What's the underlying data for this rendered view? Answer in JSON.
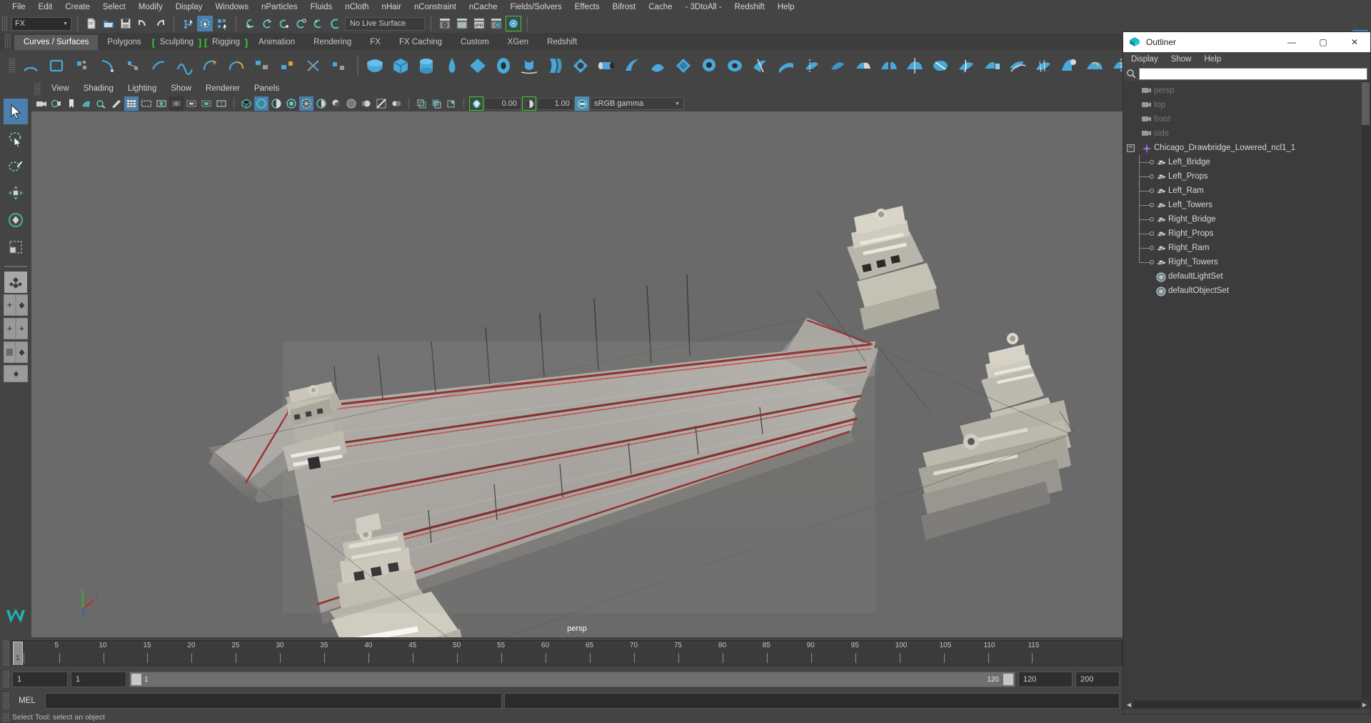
{
  "app": {
    "menubar": [
      "File",
      "Edit",
      "Create",
      "Select",
      "Modify",
      "Display",
      "Windows",
      "nParticles",
      "Fluids",
      "nCloth",
      "nHair",
      "nConstraint",
      "nCache",
      "Fields/Solvers",
      "Effects",
      "Bifrost",
      "Cache",
      "- 3DtoAll -",
      "Redshift",
      "Help"
    ]
  },
  "statusline": {
    "menuset": "FX",
    "menuset_arrow": "▼",
    "live_surface": "No Live Surface",
    "icons": [
      "new-scene-icon",
      "open-scene-icon",
      "save-scene-icon",
      "undo-icon",
      "redo-icon",
      "select-by-hierarchy-icon",
      "select-by-object-icon",
      "select-by-component-icon",
      "snap-to-grid-icon",
      "snap-to-curve-icon",
      "snap-to-point-icon",
      "snap-to-projected-center-icon",
      "snap-to-view-plane-icon",
      "make-live-icon",
      "render-view-icon",
      "render-current-frame-icon",
      "ipr-render-icon",
      "render-settings-icon",
      "hypershade-icon"
    ],
    "right_icons": [
      "sidebar-attribute-editor-icon",
      "sidebar-tool-settings-icon",
      "sidebar-channel-box-icon",
      "sidebar-layer-editor-icon"
    ]
  },
  "shelf": {
    "tabs": [
      {
        "label": "Curves / Surfaces",
        "active": true,
        "bracket": false
      },
      {
        "label": "Polygons",
        "active": false,
        "bracket": false
      },
      {
        "label": "Sculpting",
        "active": false,
        "bracket": true
      },
      {
        "label": "Rigging",
        "active": false,
        "bracket": true
      },
      {
        "label": "Animation",
        "active": false,
        "bracket": false
      },
      {
        "label": "Rendering",
        "active": false,
        "bracket": false
      },
      {
        "label": "FX",
        "active": false,
        "bracket": false
      },
      {
        "label": "FX Caching",
        "active": false,
        "bracket": false
      },
      {
        "label": "Custom",
        "active": false,
        "bracket": false
      },
      {
        "label": "XGen",
        "active": false,
        "bracket": false
      },
      {
        "label": "Redshift",
        "active": false,
        "bracket": false
      }
    ],
    "icons": [
      "nurbs-arc-icon",
      "nurbs-square-icon",
      "nurbs-text-icon",
      "nurbs-curve-ep-icon",
      "nurbs-curve-cv-icon",
      "nurbs-pencil-curve-icon",
      "nurbs-bezier-icon",
      "nurbs-three-point-arc-icon",
      "nurbs-attach-curve-icon",
      "nurbs-detach-curve-icon",
      "nurbs-open-close-curve-icon",
      "nurbs-cut-curve-icon",
      "nurbs-fillet-curve-icon",
      "nurbs-insert-knot-icon",
      "nurbs-offset-curve-icon",
      "nurbs-rebuild-curve-icon",
      "nurbs-reverse-curve-icon",
      "nurbs-sphere-icon",
      "nurbs-cube-icon",
      "nurbs-cylinder-icon",
      "nurbs-cone-icon",
      "nurbs-plane-icon",
      "nurbs-torus-icon",
      "nurbs-revolve-icon",
      "nurbs-loft-icon",
      "nurbs-planar-icon",
      "nurbs-extrude-icon",
      "nurbs-birail-icon",
      "nurbs-boundary-icon",
      "nurbs-square-surface-icon",
      "nurbs-bevel-icon",
      "nurbs-bevel-plus-icon",
      "nurbs-intersect-surfaces-icon",
      "nurbs-project-curve-icon",
      "nurbs-trim-tool-icon",
      "nurbs-untrim-icon",
      "nurbs-attach-surfaces-icon",
      "nurbs-detach-surfaces-icon",
      "nurbs-align-surfaces-icon",
      "nurbs-open-close-surfaces-icon",
      "nurbs-insert-isoparm-icon",
      "nurbs-extend-surface-icon",
      "nurbs-offset-surface-icon",
      "nurbs-rebuild-surface-icon",
      "nurbs-round-tool-icon",
      "nurbs-surface-fillet-icon",
      "nurbs-stitch-icon",
      "nurbs-sculpt-geometry-icon",
      "nurbs-surface-editing-icon"
    ]
  },
  "toolbox": {
    "tools": [
      {
        "name": "select-tool",
        "active": true
      },
      {
        "name": "lasso-select-tool",
        "active": false
      },
      {
        "name": "paint-select-tool",
        "active": false
      },
      {
        "name": "move-tool",
        "active": false
      },
      {
        "name": "rotate-tool",
        "active": false
      },
      {
        "name": "scale-tool",
        "active": false
      }
    ],
    "layout_buttons": [
      "single-perspective-layout",
      "four-view-layout",
      "persp-outliner-layout",
      "persp-graph-layout",
      "outliner-persp-layout",
      "hypershade-persp-layout",
      "persp-only-layout"
    ]
  },
  "viewport": {
    "menus": [
      "View",
      "Shading",
      "Lighting",
      "Show",
      "Renderer",
      "Panels"
    ],
    "camera_label": "persp",
    "exposure_value": "0.00",
    "gamma_value": "1.00",
    "color_management": "sRGB gamma",
    "dropdown_arrow": "▼",
    "toolbar_icons": [
      "select-camera-icon",
      "camera-attributes-icon",
      "bookmark-icon",
      "image-plane-icon",
      "two-d-pan-zoom-icon",
      "grease-pencil-icon",
      "grid-toggle-icon",
      "film-gate-icon",
      "resolution-gate-icon",
      "gate-mask-icon",
      "film-origin-icon",
      "safe-action-icon",
      "safe-title-icon",
      "wireframe-shading-icon",
      "smooth-shade-all-icon",
      "smooth-shade-selected-icon",
      "flat-shade-icon",
      "shaded-wireframe-icon",
      "textured-icon",
      "lighting-icon",
      "shadows-icon",
      "screen-space-ao-icon",
      "motion-blur-icon",
      "multisample-aa-icon",
      "depth-of-field-icon",
      "isolate-select-icon",
      "xray-icon",
      "xray-joints-icon",
      "xray-active-components-icon",
      "exposure-icon",
      "gamma-icon",
      "color-management-icon"
    ],
    "axis_labels": [
      "x",
      "y",
      "z"
    ],
    "axis_colors": {
      "x": "#d02020",
      "y": "#2fbf2f",
      "z": "#2e5fd0"
    }
  },
  "timeline": {
    "ticks": [
      1,
      5,
      10,
      15,
      20,
      25,
      30,
      35,
      40,
      45,
      50,
      55,
      60,
      65,
      70,
      75,
      80,
      85,
      90,
      95,
      100,
      105,
      110,
      115
    ],
    "current_frame": "1",
    "range_start": "1",
    "range_end": "120",
    "anim_start": "1",
    "anim_end": "120",
    "playback_end": "200",
    "slider_start_value": "1",
    "slider_end_value": "120"
  },
  "command_line": {
    "language": "MEL",
    "input_value": "",
    "output_value": ""
  },
  "help_line": {
    "text": "Select Tool: select an object"
  },
  "outliner": {
    "title": "Outliner",
    "window_icon": "maya-outliner-icon",
    "minimize": "—",
    "maximize": "▢",
    "close": "✕",
    "menus": [
      "Display",
      "Show",
      "Help"
    ],
    "search_value": "",
    "items": [
      {
        "label": "persp",
        "icon": "camera-icon",
        "depth": 0,
        "dim": true,
        "expand": false,
        "tree": "none"
      },
      {
        "label": "top",
        "icon": "camera-icon",
        "depth": 0,
        "dim": true,
        "expand": false,
        "tree": "none"
      },
      {
        "label": "front",
        "icon": "camera-icon",
        "depth": 0,
        "dim": true,
        "expand": false,
        "tree": "none"
      },
      {
        "label": "side",
        "icon": "camera-icon",
        "depth": 0,
        "dim": true,
        "expand": false,
        "tree": "none"
      },
      {
        "label": "Chicago_Drawbridge_Lowered_ncl1_1",
        "icon": "group-icon",
        "depth": 0,
        "dim": false,
        "expand": true,
        "tree": "none"
      },
      {
        "label": "Left_Bridge",
        "icon": "mesh-icon",
        "depth": 1,
        "dim": false,
        "expand": false,
        "tree": "mid"
      },
      {
        "label": "Left_Props",
        "icon": "mesh-icon",
        "depth": 1,
        "dim": false,
        "expand": false,
        "tree": "mid"
      },
      {
        "label": "Left_Ram",
        "icon": "mesh-icon",
        "depth": 1,
        "dim": false,
        "expand": false,
        "tree": "mid"
      },
      {
        "label": "Left_Towers",
        "icon": "mesh-icon",
        "depth": 1,
        "dim": false,
        "expand": false,
        "tree": "mid"
      },
      {
        "label": "Right_Bridge",
        "icon": "mesh-icon",
        "depth": 1,
        "dim": false,
        "expand": false,
        "tree": "mid"
      },
      {
        "label": "Right_Props",
        "icon": "mesh-icon",
        "depth": 1,
        "dim": false,
        "expand": false,
        "tree": "mid"
      },
      {
        "label": "Right_Ram",
        "icon": "mesh-icon",
        "depth": 1,
        "dim": false,
        "expand": false,
        "tree": "mid"
      },
      {
        "label": "Right_Towers",
        "icon": "mesh-icon",
        "depth": 1,
        "dim": false,
        "expand": false,
        "tree": "last"
      },
      {
        "label": "defaultLightSet",
        "icon": "set-icon",
        "depth": 1,
        "dim": false,
        "expand": false,
        "tree": "none"
      },
      {
        "label": "defaultObjectSet",
        "icon": "set-icon",
        "depth": 1,
        "dim": false,
        "expand": false,
        "tree": "none"
      }
    ],
    "scroll_left_arrow": "◀",
    "scroll_right_arrow": "▶"
  },
  "colors": {
    "accent_blue": "#4a7fae",
    "shelf_icon_blue": "#3f9fd0",
    "green_bracket": "#2ad82a",
    "viewport_bg": "#6a6a6a",
    "panel_bg": "#444444",
    "dark_bg": "#2e2e2e"
  }
}
